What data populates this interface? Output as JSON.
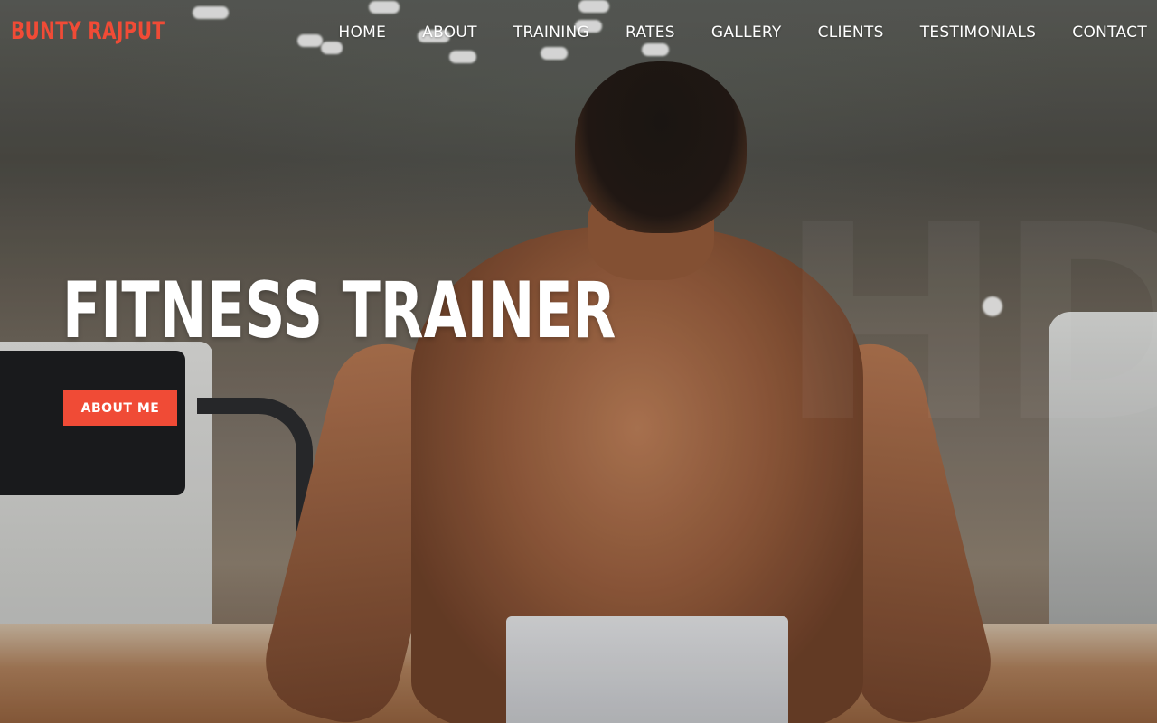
{
  "brand": {
    "logo_text": "BUNTY RAJPUT",
    "accent_color": "#f04b36"
  },
  "nav": {
    "items": [
      {
        "label": "HOME"
      },
      {
        "label": "ABOUT"
      },
      {
        "label": "TRAINING"
      },
      {
        "label": "RATES"
      },
      {
        "label": "GALLERY"
      },
      {
        "label": "CLIENTS"
      },
      {
        "label": "TESTIMONIALS"
      },
      {
        "label": "CONTACT"
      }
    ]
  },
  "hero": {
    "title": "FITNESS TRAINER",
    "button_label": "ABOUT ME",
    "watermark": "HD",
    "background_image": "photo of shirtless trainer from behind on treadmill in gym"
  }
}
